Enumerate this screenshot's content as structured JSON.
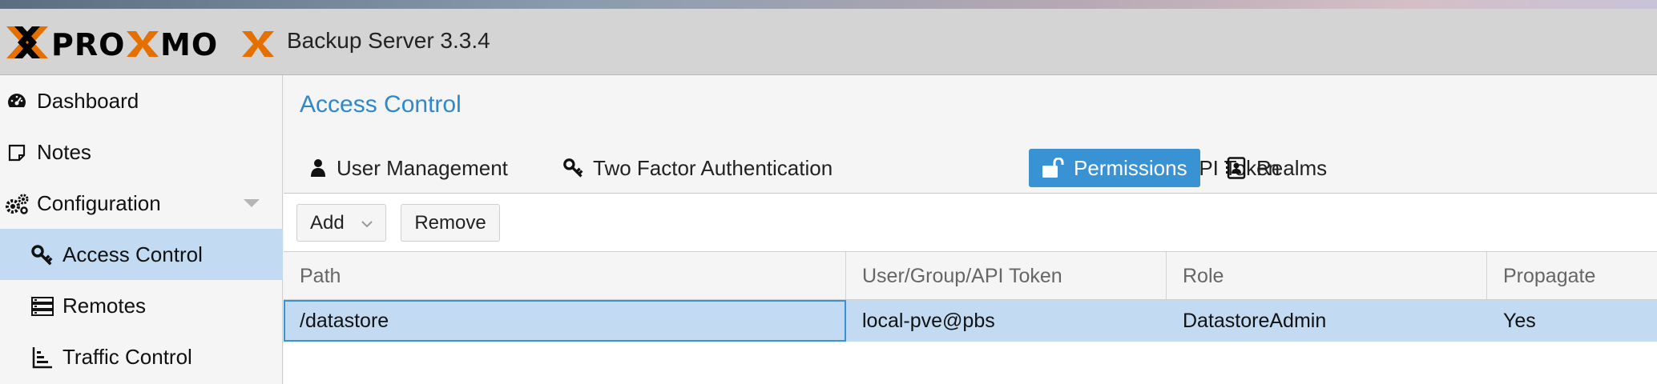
{
  "header": {
    "logo_text": "PROXMOX",
    "version": "Backup Server 3.3.4"
  },
  "sidebar": {
    "items": [
      {
        "label": "Dashboard",
        "icon": "dashboard-icon"
      },
      {
        "label": "Notes",
        "icon": "note-icon"
      },
      {
        "label": "Configuration",
        "icon": "gears-icon"
      },
      {
        "label": "Access Control",
        "icon": "key-icon",
        "selected": true
      },
      {
        "label": "Remotes",
        "icon": "server-icon"
      },
      {
        "label": "Traffic Control",
        "icon": "chart-bars-icon"
      }
    ]
  },
  "panel": {
    "title": "Access Control",
    "tabs": [
      {
        "label": "User Management",
        "icon": "user-icon"
      },
      {
        "label": "Two Factor Authentication",
        "icon": "key-icon"
      },
      {
        "label": "API Token",
        "icon": "user-outline-icon"
      },
      {
        "label": "Permissions",
        "icon": "unlock-icon",
        "active": true
      },
      {
        "label": "Realms",
        "icon": "address-book-icon"
      }
    ]
  },
  "toolbar": {
    "add_label": "Add",
    "remove_label": "Remove"
  },
  "grid": {
    "columns": [
      "Path",
      "User/Group/API Token",
      "Role",
      "Propagate"
    ],
    "rows": [
      {
        "path": "/datastore",
        "ugid": "local-pve@pbs",
        "role": "DatastoreAdmin",
        "propagate": "Yes"
      }
    ]
  },
  "colors": {
    "accent": "#3892d4",
    "selection": "#c2dbf2",
    "title_blue": "#2f88c9",
    "logo_orange": "#e57000"
  }
}
